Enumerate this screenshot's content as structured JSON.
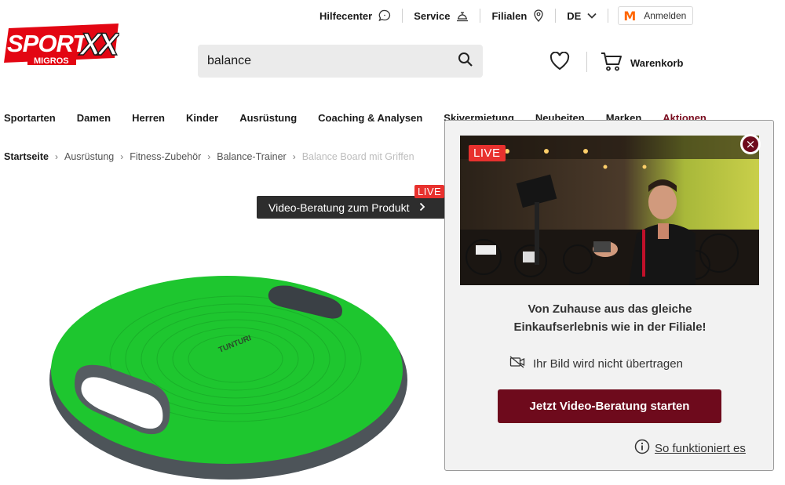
{
  "brand": {
    "logo_text_main": "SPORTXX",
    "logo_text_sub": "MIGROS",
    "red": "#e30613"
  },
  "utilbar": {
    "help": "Hilfecenter",
    "service": "Service",
    "stores": "Filialen",
    "language": "DE",
    "login_logo": "M",
    "login": "Anmelden"
  },
  "search": {
    "value": "balance",
    "icon": "search-icon"
  },
  "header": {
    "cart": "Warenkorb",
    "wishlist_icon": "heart-icon",
    "cart_icon": "cart-icon"
  },
  "nav": {
    "items": [
      "Sportarten",
      "Damen",
      "Herren",
      "Kinder",
      "Ausrüstung",
      "Coaching & Analysen",
      "Skivermietung",
      "Neuheiten",
      "Marken",
      "Aktionen"
    ]
  },
  "breadcrumb": {
    "items": [
      "Startseite",
      "Ausrüstung",
      "Fitness-Zubehör",
      "Balance-Trainer"
    ],
    "current": "Balance Board mit Griffen"
  },
  "video_tab": {
    "label": "Video-Beratung zum Produkt",
    "live": "LIVE"
  },
  "product": {
    "brand_on_board": "TUNTURI",
    "board_color": "#1ec62f"
  },
  "popup": {
    "live": "LIVE",
    "headline_line1": "Von Zuhause aus das gleiche",
    "headline_line2": "Einkaufserlebnis wie in der Filiale!",
    "privacy": "Ihr Bild wird nicht übertragen",
    "cta": "Jetzt Video-Beratung starten",
    "howto": "So funktioniert es",
    "accent": "#6e0a1c"
  }
}
